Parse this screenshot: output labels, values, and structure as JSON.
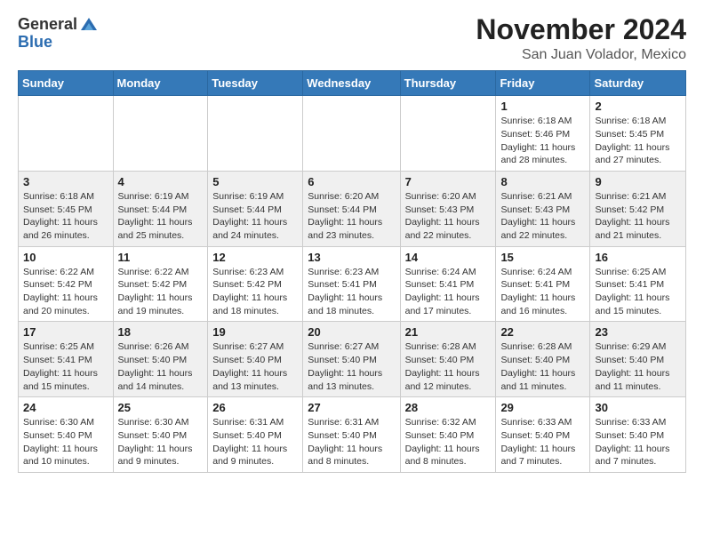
{
  "header": {
    "logo_general": "General",
    "logo_blue": "Blue",
    "month_title": "November 2024",
    "location": "San Juan Volador, Mexico"
  },
  "days_of_week": [
    "Sunday",
    "Monday",
    "Tuesday",
    "Wednesday",
    "Thursday",
    "Friday",
    "Saturday"
  ],
  "weeks": [
    [
      {
        "day": "",
        "info": ""
      },
      {
        "day": "",
        "info": ""
      },
      {
        "day": "",
        "info": ""
      },
      {
        "day": "",
        "info": ""
      },
      {
        "day": "",
        "info": ""
      },
      {
        "day": "1",
        "info": "Sunrise: 6:18 AM\nSunset: 5:46 PM\nDaylight: 11 hours and 28 minutes."
      },
      {
        "day": "2",
        "info": "Sunrise: 6:18 AM\nSunset: 5:45 PM\nDaylight: 11 hours and 27 minutes."
      }
    ],
    [
      {
        "day": "3",
        "info": "Sunrise: 6:18 AM\nSunset: 5:45 PM\nDaylight: 11 hours and 26 minutes."
      },
      {
        "day": "4",
        "info": "Sunrise: 6:19 AM\nSunset: 5:44 PM\nDaylight: 11 hours and 25 minutes."
      },
      {
        "day": "5",
        "info": "Sunrise: 6:19 AM\nSunset: 5:44 PM\nDaylight: 11 hours and 24 minutes."
      },
      {
        "day": "6",
        "info": "Sunrise: 6:20 AM\nSunset: 5:44 PM\nDaylight: 11 hours and 23 minutes."
      },
      {
        "day": "7",
        "info": "Sunrise: 6:20 AM\nSunset: 5:43 PM\nDaylight: 11 hours and 22 minutes."
      },
      {
        "day": "8",
        "info": "Sunrise: 6:21 AM\nSunset: 5:43 PM\nDaylight: 11 hours and 22 minutes."
      },
      {
        "day": "9",
        "info": "Sunrise: 6:21 AM\nSunset: 5:42 PM\nDaylight: 11 hours and 21 minutes."
      }
    ],
    [
      {
        "day": "10",
        "info": "Sunrise: 6:22 AM\nSunset: 5:42 PM\nDaylight: 11 hours and 20 minutes."
      },
      {
        "day": "11",
        "info": "Sunrise: 6:22 AM\nSunset: 5:42 PM\nDaylight: 11 hours and 19 minutes."
      },
      {
        "day": "12",
        "info": "Sunrise: 6:23 AM\nSunset: 5:42 PM\nDaylight: 11 hours and 18 minutes."
      },
      {
        "day": "13",
        "info": "Sunrise: 6:23 AM\nSunset: 5:41 PM\nDaylight: 11 hours and 18 minutes."
      },
      {
        "day": "14",
        "info": "Sunrise: 6:24 AM\nSunset: 5:41 PM\nDaylight: 11 hours and 17 minutes."
      },
      {
        "day": "15",
        "info": "Sunrise: 6:24 AM\nSunset: 5:41 PM\nDaylight: 11 hours and 16 minutes."
      },
      {
        "day": "16",
        "info": "Sunrise: 6:25 AM\nSunset: 5:41 PM\nDaylight: 11 hours and 15 minutes."
      }
    ],
    [
      {
        "day": "17",
        "info": "Sunrise: 6:25 AM\nSunset: 5:41 PM\nDaylight: 11 hours and 15 minutes."
      },
      {
        "day": "18",
        "info": "Sunrise: 6:26 AM\nSunset: 5:40 PM\nDaylight: 11 hours and 14 minutes."
      },
      {
        "day": "19",
        "info": "Sunrise: 6:27 AM\nSunset: 5:40 PM\nDaylight: 11 hours and 13 minutes."
      },
      {
        "day": "20",
        "info": "Sunrise: 6:27 AM\nSunset: 5:40 PM\nDaylight: 11 hours and 13 minutes."
      },
      {
        "day": "21",
        "info": "Sunrise: 6:28 AM\nSunset: 5:40 PM\nDaylight: 11 hours and 12 minutes."
      },
      {
        "day": "22",
        "info": "Sunrise: 6:28 AM\nSunset: 5:40 PM\nDaylight: 11 hours and 11 minutes."
      },
      {
        "day": "23",
        "info": "Sunrise: 6:29 AM\nSunset: 5:40 PM\nDaylight: 11 hours and 11 minutes."
      }
    ],
    [
      {
        "day": "24",
        "info": "Sunrise: 6:30 AM\nSunset: 5:40 PM\nDaylight: 11 hours and 10 minutes."
      },
      {
        "day": "25",
        "info": "Sunrise: 6:30 AM\nSunset: 5:40 PM\nDaylight: 11 hours and 9 minutes."
      },
      {
        "day": "26",
        "info": "Sunrise: 6:31 AM\nSunset: 5:40 PM\nDaylight: 11 hours and 9 minutes."
      },
      {
        "day": "27",
        "info": "Sunrise: 6:31 AM\nSunset: 5:40 PM\nDaylight: 11 hours and 8 minutes."
      },
      {
        "day": "28",
        "info": "Sunrise: 6:32 AM\nSunset: 5:40 PM\nDaylight: 11 hours and 8 minutes."
      },
      {
        "day": "29",
        "info": "Sunrise: 6:33 AM\nSunset: 5:40 PM\nDaylight: 11 hours and 7 minutes."
      },
      {
        "day": "30",
        "info": "Sunrise: 6:33 AM\nSunset: 5:40 PM\nDaylight: 11 hours and 7 minutes."
      }
    ]
  ]
}
